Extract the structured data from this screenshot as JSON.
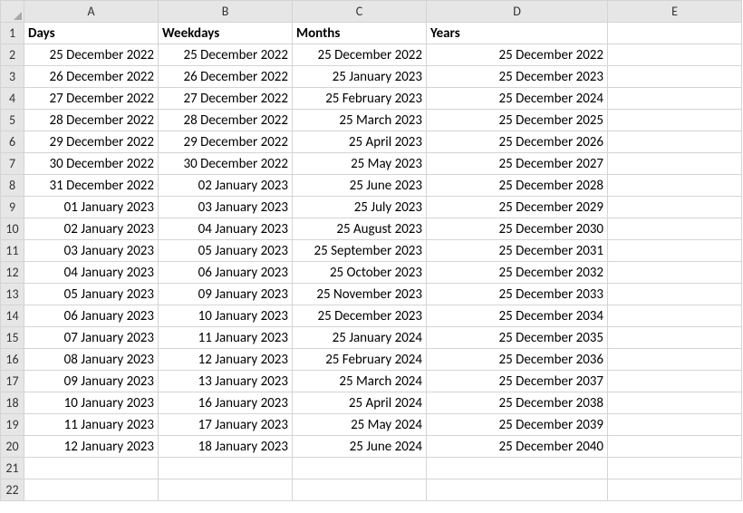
{
  "columns": [
    "A",
    "B",
    "C",
    "D",
    "E"
  ],
  "headerRow": {
    "A": "Days",
    "B": "Weekdays",
    "C": "Months",
    "D": "Years",
    "E": ""
  },
  "rows": [
    {
      "n": 2,
      "A": "25 December 2022",
      "B": "25 December 2022",
      "C": "25 December 2022",
      "D": "25 December 2022",
      "E": ""
    },
    {
      "n": 3,
      "A": "26 December 2022",
      "B": "26 December 2022",
      "C": "25 January 2023",
      "D": "25 December 2023",
      "E": ""
    },
    {
      "n": 4,
      "A": "27 December 2022",
      "B": "27 December 2022",
      "C": "25 February 2023",
      "D": "25 December 2024",
      "E": ""
    },
    {
      "n": 5,
      "A": "28 December 2022",
      "B": "28 December 2022",
      "C": "25 March 2023",
      "D": "25 December 2025",
      "E": ""
    },
    {
      "n": 6,
      "A": "29 December 2022",
      "B": "29 December 2022",
      "C": "25 April 2023",
      "D": "25 December 2026",
      "E": ""
    },
    {
      "n": 7,
      "A": "30 December 2022",
      "B": "30 December 2022",
      "C": "25 May 2023",
      "D": "25 December 2027",
      "E": ""
    },
    {
      "n": 8,
      "A": "31 December 2022",
      "B": "02 January 2023",
      "C": "25 June 2023",
      "D": "25 December 2028",
      "E": ""
    },
    {
      "n": 9,
      "A": "01 January 2023",
      "B": "03 January 2023",
      "C": "25 July 2023",
      "D": "25 December 2029",
      "E": ""
    },
    {
      "n": 10,
      "A": "02 January 2023",
      "B": "04 January 2023",
      "C": "25 August 2023",
      "D": "25 December 2030",
      "E": ""
    },
    {
      "n": 11,
      "A": "03 January 2023",
      "B": "05 January 2023",
      "C": "25 September 2023",
      "D": "25 December 2031",
      "E": ""
    },
    {
      "n": 12,
      "A": "04 January 2023",
      "B": "06 January 2023",
      "C": "25 October 2023",
      "D": "25 December 2032",
      "E": ""
    },
    {
      "n": 13,
      "A": "05 January 2023",
      "B": "09 January 2023",
      "C": "25 November 2023",
      "D": "25 December 2033",
      "E": ""
    },
    {
      "n": 14,
      "A": "06 January 2023",
      "B": "10 January 2023",
      "C": "25 December 2023",
      "D": "25 December 2034",
      "E": ""
    },
    {
      "n": 15,
      "A": "07 January 2023",
      "B": "11 January 2023",
      "C": "25 January 2024",
      "D": "25 December 2035",
      "E": ""
    },
    {
      "n": 16,
      "A": "08 January 2023",
      "B": "12 January 2023",
      "C": "25 February 2024",
      "D": "25 December 2036",
      "E": ""
    },
    {
      "n": 17,
      "A": "09 January 2023",
      "B": "13 January 2023",
      "C": "25 March 2024",
      "D": "25 December 2037",
      "E": ""
    },
    {
      "n": 18,
      "A": "10 January 2023",
      "B": "16 January 2023",
      "C": "25 April 2024",
      "D": "25 December 2038",
      "E": ""
    },
    {
      "n": 19,
      "A": "11 January 2023",
      "B": "17 January 2023",
      "C": "25 May 2024",
      "D": "25 December 2039",
      "E": ""
    },
    {
      "n": 20,
      "A": "12 January 2023",
      "B": "18 January 2023",
      "C": "25 June 2024",
      "D": "25 December 2040",
      "E": ""
    },
    {
      "n": 21,
      "A": "",
      "B": "",
      "C": "",
      "D": "",
      "E": ""
    },
    {
      "n": 22,
      "A": "",
      "B": "",
      "C": "",
      "D": "",
      "E": ""
    }
  ],
  "chart_data": {
    "type": "table",
    "title": "",
    "columns": [
      "Days",
      "Weekdays",
      "Months",
      "Years"
    ],
    "data": [
      [
        "25 December 2022",
        "25 December 2022",
        "25 December 2022",
        "25 December 2022"
      ],
      [
        "26 December 2022",
        "26 December 2022",
        "25 January 2023",
        "25 December 2023"
      ],
      [
        "27 December 2022",
        "27 December 2022",
        "25 February 2023",
        "25 December 2024"
      ],
      [
        "28 December 2022",
        "28 December 2022",
        "25 March 2023",
        "25 December 2025"
      ],
      [
        "29 December 2022",
        "29 December 2022",
        "25 April 2023",
        "25 December 2026"
      ],
      [
        "30 December 2022",
        "30 December 2022",
        "25 May 2023",
        "25 December 2027"
      ],
      [
        "31 December 2022",
        "02 January 2023",
        "25 June 2023",
        "25 December 2028"
      ],
      [
        "01 January 2023",
        "03 January 2023",
        "25 July 2023",
        "25 December 2029"
      ],
      [
        "02 January 2023",
        "04 January 2023",
        "25 August 2023",
        "25 December 2030"
      ],
      [
        "03 January 2023",
        "05 January 2023",
        "25 September 2023",
        "25 December 2031"
      ],
      [
        "04 January 2023",
        "06 January 2023",
        "25 October 2023",
        "25 December 2032"
      ],
      [
        "05 January 2023",
        "09 January 2023",
        "25 November 2023",
        "25 December 2033"
      ],
      [
        "06 January 2023",
        "10 January 2023",
        "25 December 2023",
        "25 December 2034"
      ],
      [
        "07 January 2023",
        "11 January 2023",
        "25 January 2024",
        "25 December 2035"
      ],
      [
        "08 January 2023",
        "12 January 2023",
        "25 February 2024",
        "25 December 2036"
      ],
      [
        "09 January 2023",
        "13 January 2023",
        "25 March 2024",
        "25 December 2037"
      ],
      [
        "10 January 2023",
        "16 January 2023",
        "25 April 2024",
        "25 December 2038"
      ],
      [
        "11 January 2023",
        "17 January 2023",
        "25 May 2024",
        "25 December 2039"
      ],
      [
        "12 January 2023",
        "18 January 2023",
        "25 June 2024",
        "25 December 2040"
      ]
    ]
  }
}
